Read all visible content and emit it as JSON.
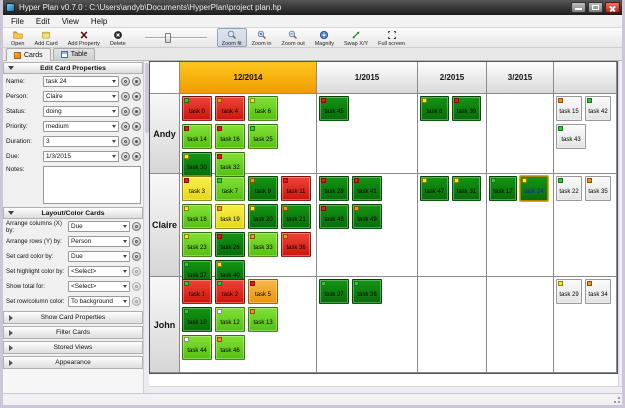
{
  "window": {
    "title": "Hyper Plan v0.7.0 : C:\\Users\\andyb\\Documents\\HyperPlan\\project plan.hp",
    "controls": [
      "minimize",
      "maximize",
      "close"
    ]
  },
  "menu": {
    "items": [
      "File",
      "Edit",
      "View",
      "Help"
    ]
  },
  "toolbar": {
    "buttons": [
      {
        "label": "Open",
        "icon": "open-folder-icon"
      },
      {
        "label": "Add Card",
        "icon": "add-card-icon"
      },
      {
        "label": "Add Property",
        "icon": "add-property-icon"
      },
      {
        "label": "Delete",
        "icon": "delete-icon"
      }
    ],
    "slider": {
      "name": "zoom-slider",
      "value_percent": 32
    },
    "zoom_buttons": [
      {
        "label": "Zoom fit",
        "icon": "zoom-fit-icon",
        "pressed": true
      },
      {
        "label": "Zoom in",
        "icon": "zoom-in-icon",
        "pressed": false
      },
      {
        "label": "Zoom out",
        "icon": "zoom-out-icon",
        "pressed": false
      },
      {
        "label": "Magnify",
        "icon": "magnify-icon",
        "pressed": false
      },
      {
        "label": "Swap X/Y",
        "icon": "swap-xy-icon",
        "pressed": false
      },
      {
        "label": "Full screen",
        "icon": "full-screen-icon",
        "pressed": false
      }
    ]
  },
  "tabs": [
    {
      "label": "Cards",
      "active": true,
      "icon": "cards-tab-icon"
    },
    {
      "label": "Table",
      "active": false,
      "icon": "table-tab-icon"
    }
  ],
  "edit_panel": {
    "title": "Edit Card Properties",
    "fields": [
      {
        "label": "Name:",
        "value": "task 24"
      },
      {
        "label": "Person:",
        "value": "Claire"
      },
      {
        "label": "Status:",
        "value": "doing"
      },
      {
        "label": "Priority:",
        "value": "medium"
      },
      {
        "label": "Duration:",
        "value": "3"
      },
      {
        "label": "Due:",
        "value": "1/3/2015"
      }
    ],
    "notes_label": "Notes:",
    "notes_value": ""
  },
  "layout_panel": {
    "title": "Layout/Color Cards",
    "fields": [
      {
        "label": "Arrange columns (X) by:",
        "value": "Due",
        "enabled": true
      },
      {
        "label": "Arrange rows (Y) by:",
        "value": "Person",
        "enabled": true
      },
      {
        "label": "Set card color by:",
        "value": "Due",
        "enabled": true
      },
      {
        "label": "Set highlight color by:",
        "value": "<Select>",
        "enabled": false
      },
      {
        "label": "Show total for:",
        "value": "<Select>",
        "enabled": false
      },
      {
        "label": "Set row/column color:",
        "value": "To background",
        "enabled": false
      }
    ]
  },
  "panel_buttons": [
    "Show Card Properties",
    "Filter Cards",
    "Stored Views",
    "Appearance"
  ],
  "grid": {
    "columns": [
      {
        "label": "",
        "highlighted": false
      },
      {
        "label": "12/2014",
        "highlighted": true
      },
      {
        "label": "1/2015",
        "highlighted": false
      },
      {
        "label": "2/2015",
        "highlighted": false
      },
      {
        "label": "3/2015",
        "highlighted": false
      },
      {
        "label": "",
        "highlighted": false
      }
    ],
    "rows": [
      {
        "label": "Andy",
        "cells": [
          [
            [
              {
                "t": "task 0",
                "c": "red",
                "h": "green"
              },
              {
                "t": "task 4",
                "c": "red",
                "h": "orange"
              },
              {
                "t": "task 6",
                "c": "lgreen",
                "h": "yellow"
              }
            ],
            [
              {
                "t": "task 14",
                "c": "lgreen",
                "h": "red"
              },
              {
                "t": "task 16",
                "c": "lgreen",
                "h": "red"
              },
              {
                "t": "task 25",
                "c": "lgreen",
                "h": "green"
              }
            ],
            [
              {
                "t": "task 30",
                "c": "dgreen",
                "h": "yellow"
              },
              {
                "t": "task 32",
                "c": "lgreen",
                "h": "red"
              }
            ]
          ],
          [
            [
              {
                "t": "task 45",
                "c": "dgreen",
                "h": "red"
              }
            ]
          ],
          [
            [
              {
                "t": "task 8",
                "c": "dgreen",
                "h": "yellow"
              },
              {
                "t": "task 39",
                "c": "dgreen",
                "h": "red"
              }
            ]
          ],
          [],
          [
            [
              {
                "t": "task 15",
                "c": "none",
                "h": "orange"
              },
              {
                "t": "task 42",
                "c": "none",
                "h": "green"
              }
            ],
            [
              {
                "t": "task 43",
                "c": "none",
                "h": "green"
              }
            ]
          ]
        ]
      },
      {
        "label": "Claire",
        "cells": [
          [
            [
              {
                "t": "task 3",
                "c": "yellow",
                "h": "red"
              },
              {
                "t": "task 7",
                "c": "lgreen",
                "h": "green"
              },
              {
                "t": "task 9",
                "c": "dgreen",
                "h": "orange"
              },
              {
                "t": "task 11",
                "c": "red",
                "h": "red"
              }
            ],
            [
              {
                "t": "task 18",
                "c": "lgreen",
                "h": "yellow"
              },
              {
                "t": "task 19",
                "c": "yellow",
                "h": "orange"
              },
              {
                "t": "task 20",
                "c": "dgreen",
                "h": "yellow"
              },
              {
                "t": "task 21",
                "c": "dgreen",
                "h": "orange"
              }
            ],
            [
              {
                "t": "task 23",
                "c": "lgreen",
                "h": "yellow"
              },
              {
                "t": "task 26",
                "c": "dgreen",
                "h": "red"
              },
              {
                "t": "task 33",
                "c": "lgreen",
                "h": "orange"
              },
              {
                "t": "task 36",
                "c": "red",
                "h": "orange"
              }
            ],
            [
              {
                "t": "task 37",
                "c": "dgreen",
                "h": "green"
              },
              {
                "t": "task 40",
                "c": "dgreen",
                "h": "yellow"
              }
            ]
          ],
          [
            [
              {
                "t": "task 28",
                "c": "dgreen",
                "h": "red"
              },
              {
                "t": "task 41",
                "c": "dgreen",
                "h": "red"
              }
            ],
            [
              {
                "t": "task 48",
                "c": "dgreen",
                "h": "red"
              },
              {
                "t": "task 49",
                "c": "dgreen",
                "h": "orange"
              }
            ]
          ],
          [
            [
              {
                "t": "task 47",
                "c": "dgreen",
                "h": "yellow"
              },
              {
                "t": "task 31",
                "c": "dgreen",
                "h": "yellow"
              }
            ]
          ],
          [
            [
              {
                "t": "task 17",
                "c": "dgreen",
                "h": "green"
              },
              {
                "t": "task 24",
                "c": "dgreen",
                "h": "yellow",
                "sel": true
              }
            ]
          ],
          [
            [
              {
                "t": "task 22",
                "c": "none",
                "h": "green"
              },
              {
                "t": "task 35",
                "c": "none",
                "h": "orange"
              }
            ]
          ]
        ]
      },
      {
        "label": "John",
        "cells": [
          [
            [
              {
                "t": "task 1",
                "c": "red",
                "h": "green"
              },
              {
                "t": "task 2",
                "c": "red",
                "h": "green"
              },
              {
                "t": "task 5",
                "c": "orange",
                "h": "red"
              }
            ],
            [
              {
                "t": "task 10",
                "c": "dgreen",
                "h": "green"
              },
              {
                "t": "task 12",
                "c": "lgreen",
                "h": "white"
              },
              {
                "t": "task 13",
                "c": "lgreen",
                "h": "orange"
              }
            ],
            [
              {
                "t": "task 44",
                "c": "lgreen",
                "h": "white"
              },
              {
                "t": "task 46",
                "c": "lgreen",
                "h": "orange"
              }
            ]
          ],
          [
            [
              {
                "t": "task 27",
                "c": "dgreen",
                "h": "green"
              },
              {
                "t": "task 38",
                "c": "dgreen",
                "h": "green"
              }
            ]
          ],
          [],
          [],
          [
            [
              {
                "t": "task 29",
                "c": "none",
                "h": "yellow"
              },
              {
                "t": "task 34",
                "c": "none",
                "h": "orange"
              }
            ]
          ]
        ]
      }
    ],
    "selected_card": "task 24"
  },
  "colors": {
    "card_red": "#d8221a",
    "card_light_green": "#6fd92b",
    "card_dark_green": "#0e860e",
    "card_yellow": "#efe72a",
    "card_orange": "#efa01e",
    "card_no_due": "#ededed",
    "highlight_green": "#2ecc2e",
    "highlight_red": "#f21414",
    "highlight_orange": "#ff9012",
    "highlight_yellow": "#ffe818",
    "header_highlight": "#f2a90c",
    "selected_card_text": "#1616cc"
  }
}
